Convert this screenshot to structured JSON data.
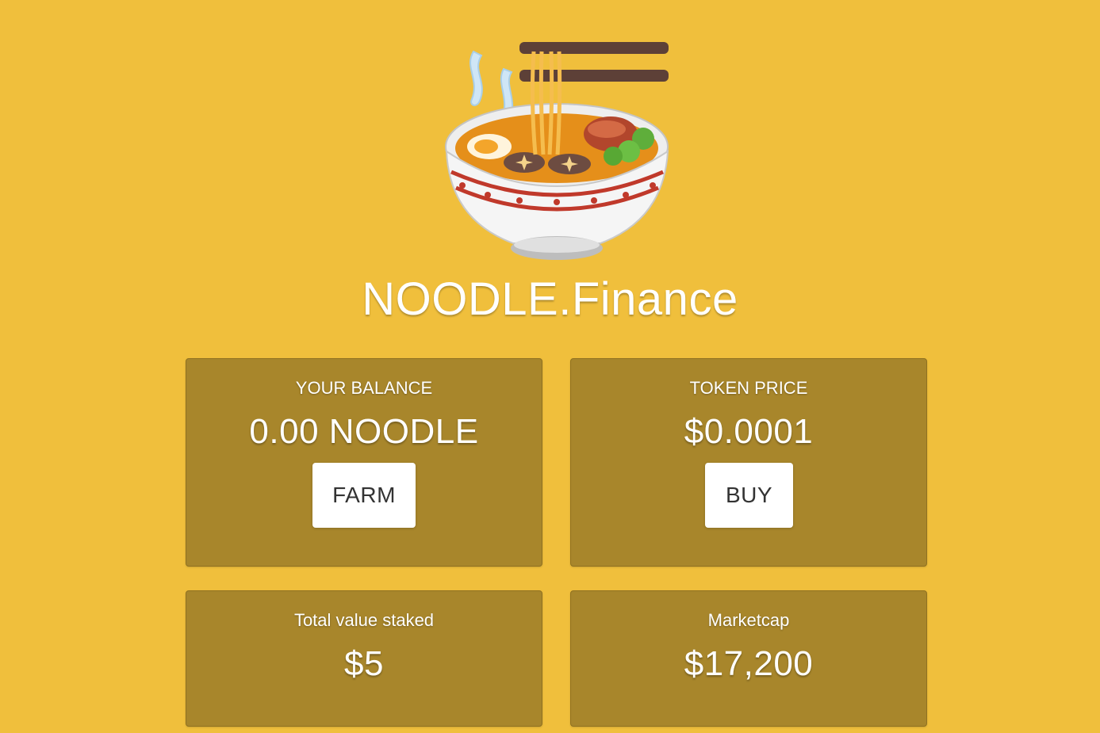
{
  "header": {
    "title": "NOODLE.Finance",
    "logo_icon": "noodle-bowl-icon"
  },
  "cards": {
    "balance": {
      "label": "YOUR BALANCE",
      "value": "0.00 NOODLE",
      "button_label": "FARM"
    },
    "price": {
      "label": "TOKEN PRICE",
      "value": "$0.0001",
      "button_label": "BUY"
    },
    "staked": {
      "label": "Total value staked",
      "value": "$5"
    },
    "marketcap": {
      "label": "Marketcap",
      "value": "$17,200"
    }
  },
  "colors": {
    "background": "#f0bf3c",
    "card": "#a8862b",
    "button": "#ffffff",
    "text": "#ffffff"
  }
}
